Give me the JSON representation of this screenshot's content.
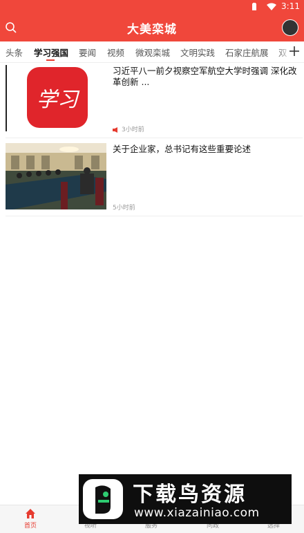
{
  "status_bar": {
    "time": "3:11"
  },
  "header": {
    "title": "大美栾城"
  },
  "tabs": [
    {
      "label": "头条"
    },
    {
      "label": "学习强国",
      "active": true
    },
    {
      "label": "要闻"
    },
    {
      "label": "视频"
    },
    {
      "label": "微观栾城"
    },
    {
      "label": "文明实践"
    },
    {
      "label": "石家庄航展"
    },
    {
      "label": "双"
    }
  ],
  "news": [
    {
      "headline": "习近平八一前夕视察空军航空大学时强调 深化改革创新 ...",
      "time": "3小时前",
      "thumbnail_text": "学习",
      "has_audio": true
    },
    {
      "headline": "关于企业家，总书记有这些重要论述",
      "time": "5小时前",
      "thumbnail_text": "",
      "has_audio": false
    }
  ],
  "bottom_nav": [
    {
      "label": "首页",
      "active": true
    },
    {
      "label": "视听"
    },
    {
      "label": "服务"
    },
    {
      "label": "问政"
    },
    {
      "label": "选择"
    }
  ],
  "watermark": {
    "title": "下载鸟资源",
    "url": "www.xiazainiao.com"
  },
  "colors": {
    "brand": "#f0473b",
    "accent": "#e63b2f",
    "text": "#222222",
    "meta": "#999999"
  }
}
